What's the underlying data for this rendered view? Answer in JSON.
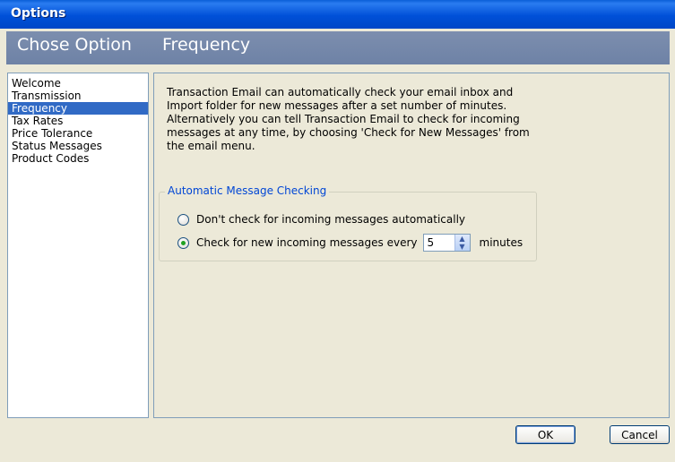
{
  "window": {
    "title": "Options"
  },
  "header": {
    "section_label": "Chose Option",
    "page_label": "Frequency"
  },
  "sidebar": {
    "items": [
      {
        "label": "Welcome",
        "selected": false
      },
      {
        "label": "Transmission",
        "selected": false
      },
      {
        "label": "Frequency",
        "selected": true
      },
      {
        "label": "Tax Rates",
        "selected": false
      },
      {
        "label": "Price Tolerance",
        "selected": false
      },
      {
        "label": "Status Messages",
        "selected": false
      },
      {
        "label": "Product Codes",
        "selected": false
      }
    ]
  },
  "main": {
    "description": "Transaction Email can automatically check your email inbox and Import folder for new messages after a set number of minutes. Alternatively you can tell Transaction Email to check for incoming messages at any time, by choosing 'Check for New Messages' from the email menu.",
    "group": {
      "legend": "Automatic Message Checking",
      "option_none_label": "Don't check for incoming messages automatically",
      "option_interval_label": "Check for new incoming messages every",
      "interval_value": "5",
      "interval_unit": "minutes",
      "selected_option": "interval"
    }
  },
  "footer": {
    "ok_label": "OK",
    "cancel_label": "Cancel"
  },
  "colors": {
    "titlebar": "#0050d8",
    "header": "#6e82a6",
    "selection": "#316ac5",
    "legend": "#0046d5"
  }
}
